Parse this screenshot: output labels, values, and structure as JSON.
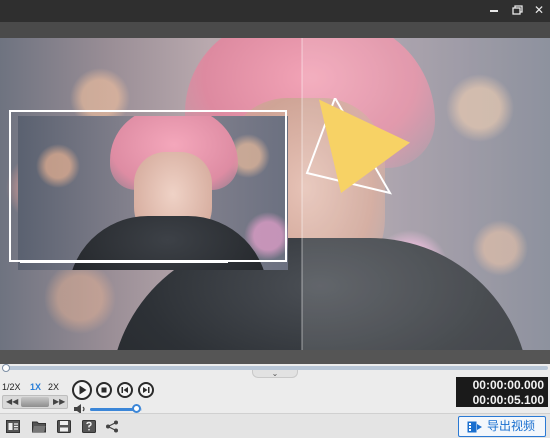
{
  "window": {
    "title_bar_buttons": {
      "minimize_icon": "minimize-icon",
      "restore_icon": "restore-icon",
      "close_symbol": "✕"
    }
  },
  "preview": {
    "overlay_colors": {
      "frame": "#ffffff",
      "triangle_fill": "#f7d265",
      "triangle_outline": "#ffffff"
    }
  },
  "timeline": {
    "progress": 0.0,
    "accent_color": "#4f86c6"
  },
  "playback": {
    "speed_options": [
      "1/2X",
      "1X",
      "2X"
    ],
    "selected_speed": "1X",
    "volume_level": 0.92
  },
  "time": {
    "current": "00:00:00.000",
    "total": "00:00:05.100"
  },
  "toolbar": {
    "icons": [
      "new-project-icon",
      "open-folder-icon",
      "save-icon",
      "save-as-icon",
      "share-icon"
    ],
    "export_label": "导出视频"
  }
}
